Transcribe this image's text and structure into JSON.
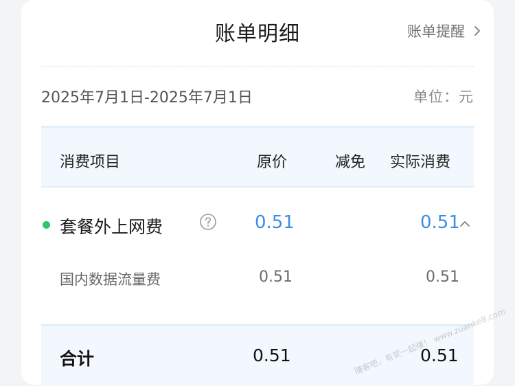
{
  "header": {
    "title": "账单明细",
    "reminder_label": "账单提醒"
  },
  "period": {
    "date_range": "2025年7月1日-2025年7月1日",
    "unit_label": "单位：元"
  },
  "table": {
    "columns": [
      "消费项目",
      "原价",
      "减免",
      "实际消费"
    ],
    "main_item": {
      "name": "套餐外上网费",
      "original": "0.51",
      "discount": "",
      "actual": "0.51"
    },
    "sub_item": {
      "name": "国内数据流量费",
      "original": "0.51",
      "actual": "0.51"
    },
    "total": {
      "label": "合计",
      "original": "0.51",
      "actual": "0.51"
    }
  },
  "watermark": "赚客吧，有奖一起赚！ www.zuanke8.com",
  "colors": {
    "accent_blue": "#3a8ee6",
    "dot_green": "#33c46b",
    "table_bg": "#f2f8fd"
  },
  "icons": {
    "reminder": "chevron-right-icon",
    "help": "question-circle-icon",
    "collapse": "chevron-up-icon"
  }
}
